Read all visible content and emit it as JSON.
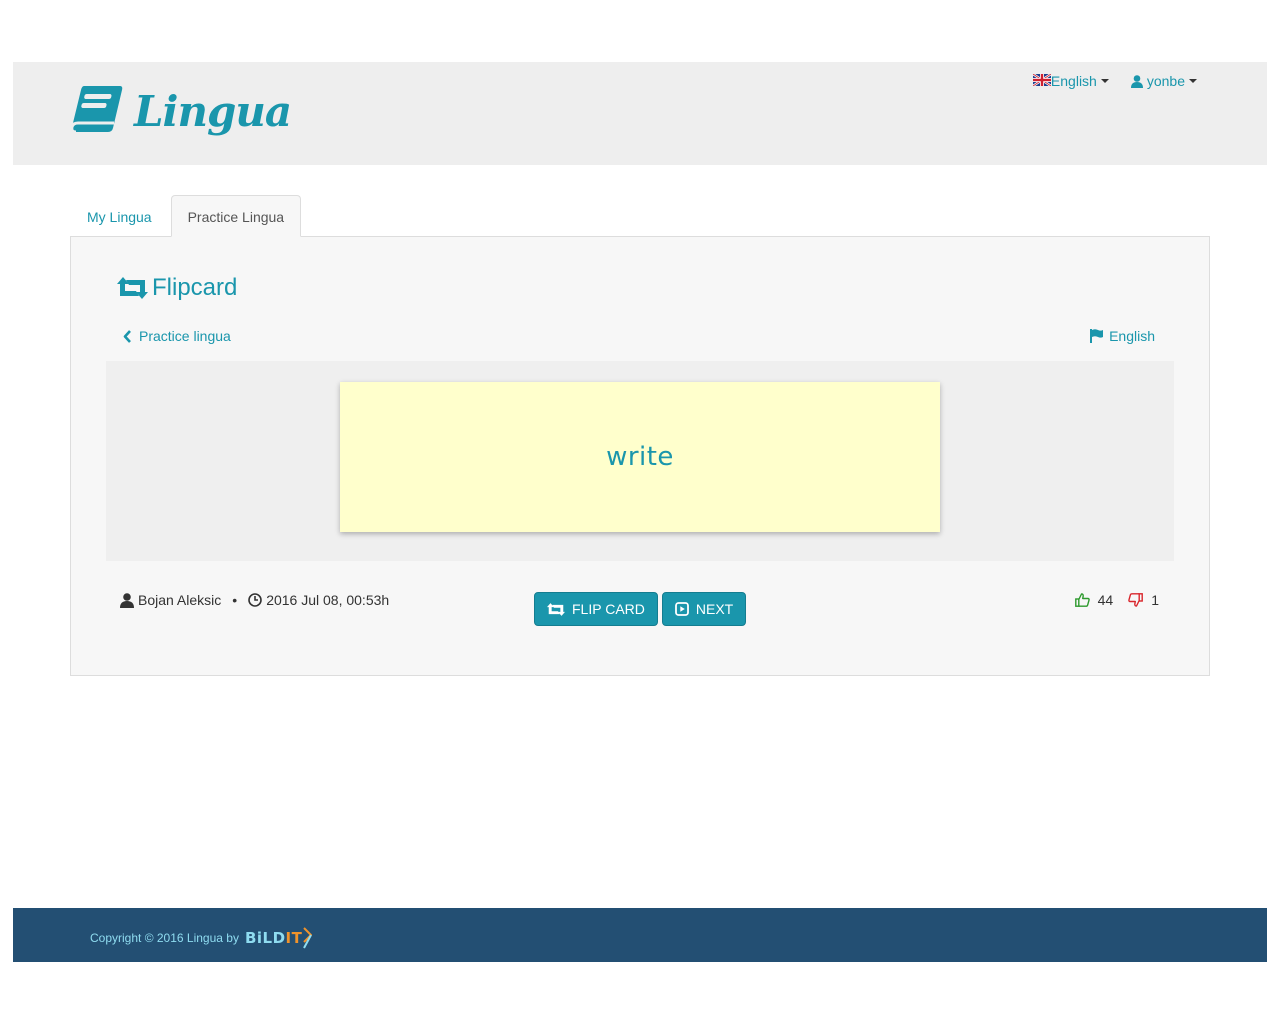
{
  "header": {
    "logo_text": "Lingua",
    "language_label": "English",
    "user_label": "yonbe"
  },
  "tabs": [
    {
      "label": "My Lingua",
      "active": false
    },
    {
      "label": "Practice Lingua",
      "active": true
    }
  ],
  "panel": {
    "title": "Flipcard",
    "back_link": "Practice lingua",
    "language": "English",
    "card_word": "write",
    "author": "Bojan Aleksic",
    "separator": "•",
    "timestamp": "2016 Jul 08, 00:53h",
    "flip_label": "FLIP CARD",
    "next_label": "NEXT",
    "likes": "44",
    "dislikes": "1"
  },
  "footer": {
    "copyright": "Copyright © 2016 Lingua by",
    "brand_part1": "BiLD",
    "brand_part2": "IT"
  },
  "colors": {
    "accent": "#1a96ac",
    "header_bg": "#eeeeee",
    "card_bg": "#ffffcc",
    "footer_bg": "#234f73",
    "like": "#2e9a2e",
    "dislike": "#d9262c"
  },
  "icons": [
    "book-icon",
    "uk-flag-icon",
    "user-icon",
    "retweet-icon",
    "chevron-left-icon",
    "flag-icon",
    "clock-icon",
    "play-square-icon",
    "thumbs-up-icon",
    "thumbs-down-icon"
  ]
}
